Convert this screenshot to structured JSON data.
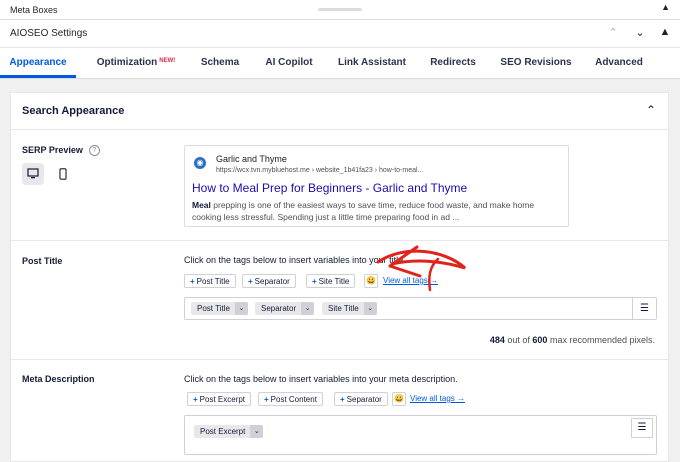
{
  "topbar": {
    "title": "Meta Boxes",
    "caret": "▲"
  },
  "aioseo_header": {
    "title": "AIOSEO Settings",
    "move_up": "⌃",
    "move_down": "⌄",
    "collapse": "▲"
  },
  "tabs": [
    {
      "label": "Appearance",
      "active": true
    },
    {
      "label": "Optimization",
      "badge": "NEW!"
    },
    {
      "label": "Schema"
    },
    {
      "label": "AI Copilot"
    },
    {
      "label": "Link Assistant"
    },
    {
      "label": "Redirects"
    },
    {
      "label": "SEO Revisions"
    },
    {
      "label": "Advanced"
    }
  ],
  "panel": {
    "title": "Search Appearance",
    "collapse_glyph": "⌃",
    "serp_preview": {
      "label": "SERP Preview",
      "help": "?",
      "site_name": "Garlic and Thyme",
      "url": "https://wcx.tvn.mybluehost.me › website_1b41fa23 › how-to-meal...",
      "headline": "How to Meal Prep for Beginners - Garlic and Thyme",
      "desc_bold": "Meal",
      "desc_rest": " prepping is one of the easiest ways to save time, reduce food waste, and make home cooking less stressful. Spending just a little time preparing food in ad ..."
    },
    "post_title": {
      "label": "Post Title",
      "hint": "Click on the tags below to insert variables into your title.",
      "tags": [
        "Post Title",
        "Separator",
        "Site Title"
      ],
      "emoji": "😀",
      "view_all": "View all tags →",
      "chips": [
        "Post Title",
        "Separator",
        "Site Title"
      ],
      "counter_value": "484",
      "counter_mid": " out of ",
      "counter_max": "600",
      "counter_tail": " max recommended pixels."
    },
    "meta_description": {
      "label": "Meta Description",
      "hint": "Click on the tags below to insert variables into your meta description.",
      "tags": [
        "Post Excerpt",
        "Post Content",
        "Separator"
      ],
      "emoji": "😀",
      "view_all": "View all tags →",
      "chips": [
        "Post Excerpt"
      ]
    }
  }
}
